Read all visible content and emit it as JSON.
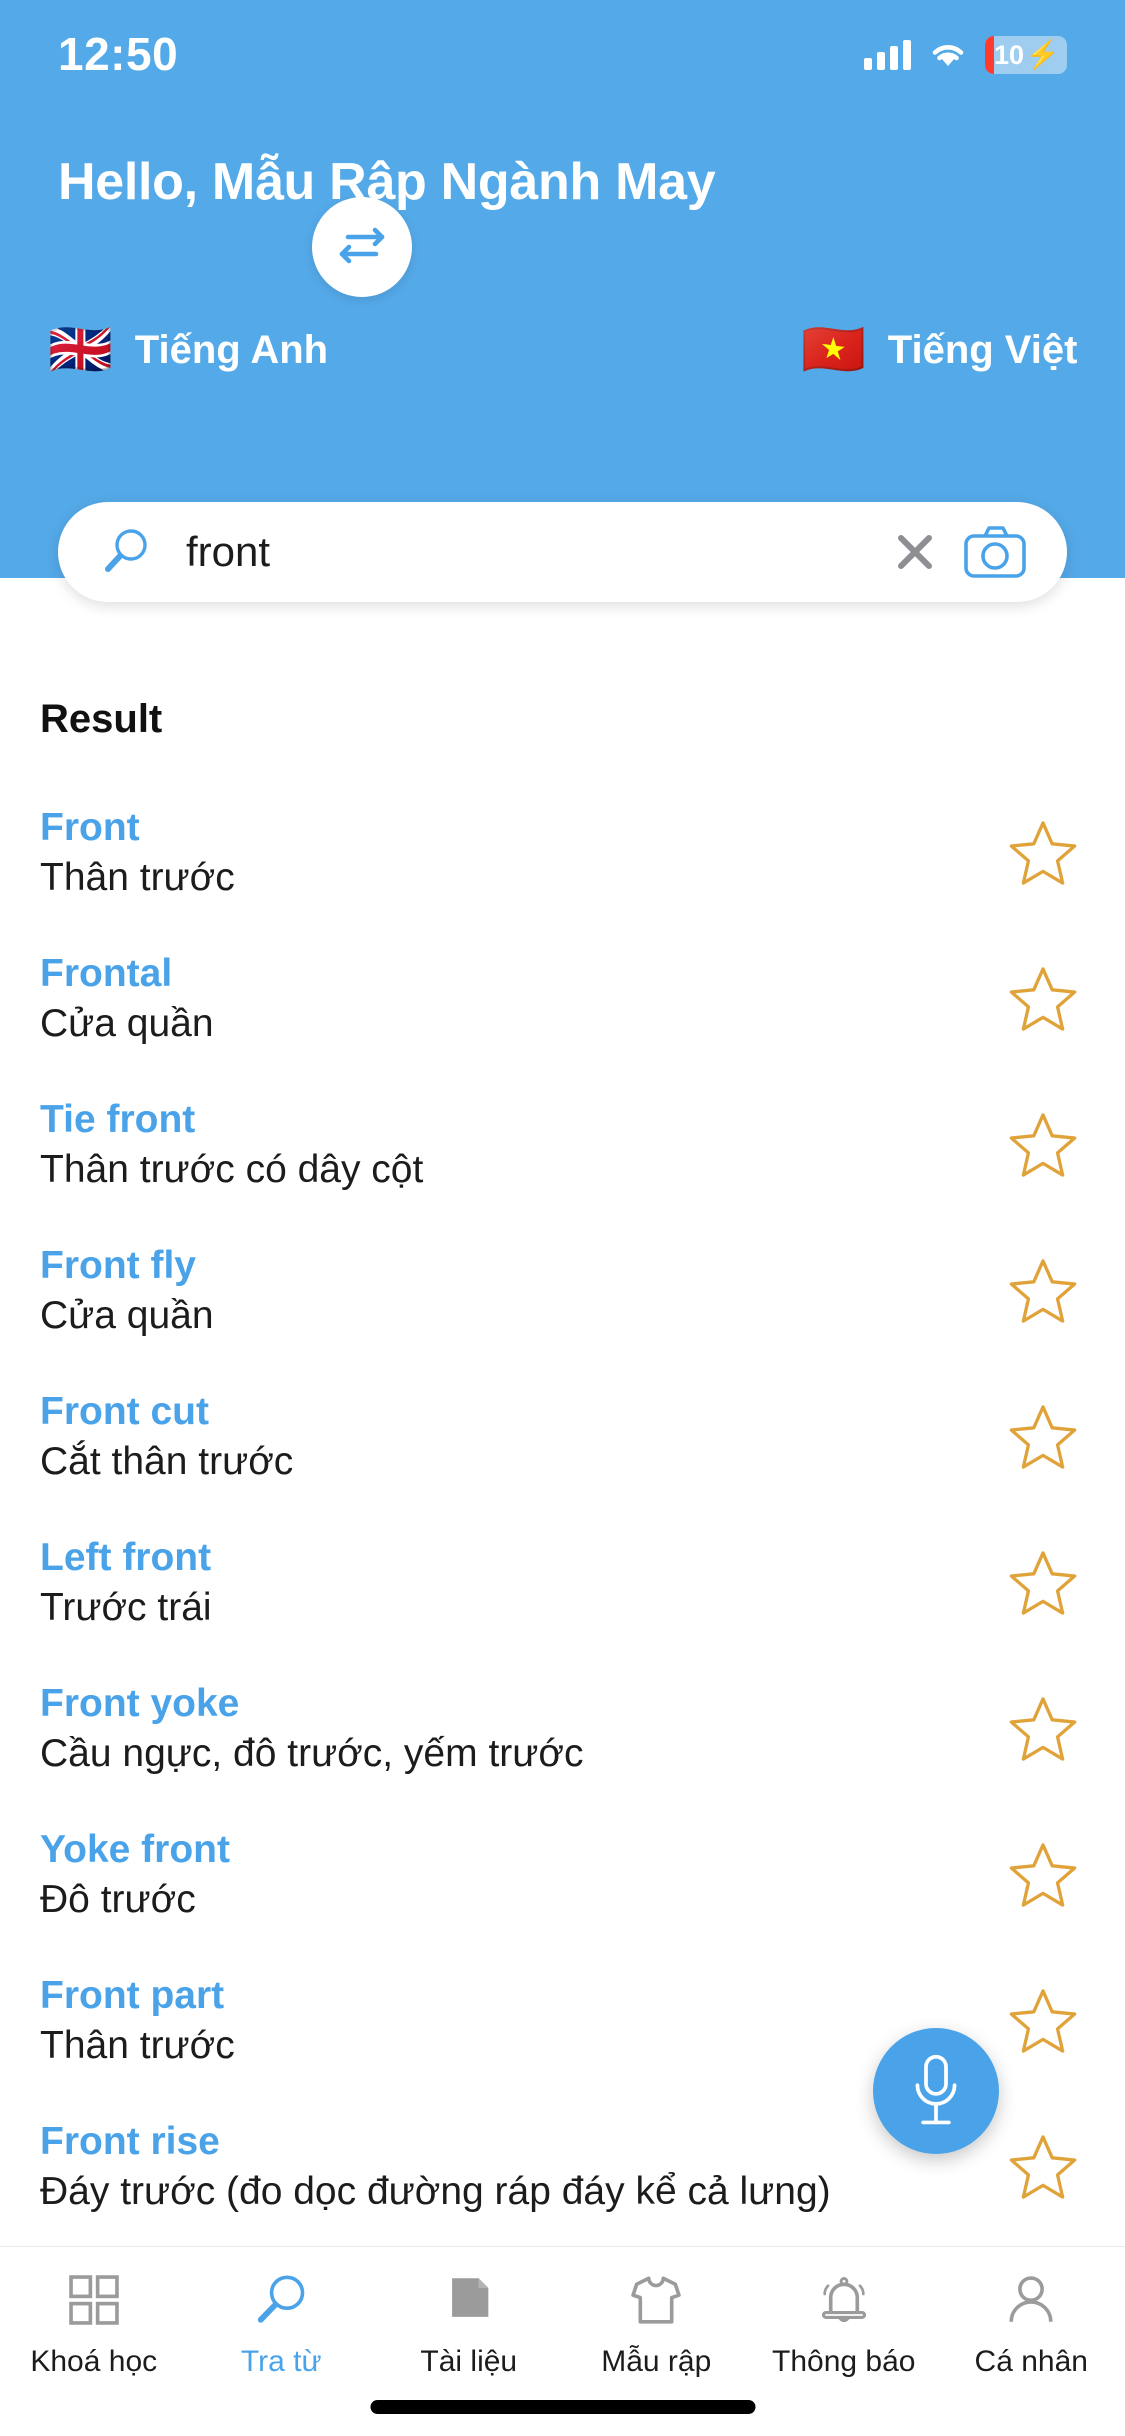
{
  "status_bar": {
    "time": "12:50",
    "battery_percent": "10",
    "charging": true,
    "signal_icon": "signal-bars-icon",
    "wifi_icon": "wifi-icon",
    "battery_icon": "battery-icon"
  },
  "header": {
    "greeting": "Hello, Mẫu Rập Ngành May",
    "background_color": "#54a9e8",
    "source_language": {
      "label": "Tiếng Anh",
      "flag": "🇬🇧"
    },
    "target_language": {
      "label": "Tiếng Việt",
      "flag": "🇻🇳"
    },
    "swap_icon": "swap-horizontal-icon"
  },
  "search": {
    "value": "front",
    "placeholder": "front",
    "search_icon": "search-icon",
    "clear_icon": "close-icon",
    "camera_icon": "camera-icon"
  },
  "results": {
    "title": "Result",
    "accent_color": "#4aa3e8",
    "star_color": "#e0a33a",
    "items": [
      {
        "term": "Front",
        "meaning": "Thân trước",
        "star_icon": "star-outline-icon"
      },
      {
        "term": "Frontal",
        "meaning": "Cửa quần",
        "star_icon": "star-outline-icon"
      },
      {
        "term": "Tie front",
        "meaning": "Thân trước có dây cột",
        "star_icon": "star-outline-icon"
      },
      {
        "term": "Front fly",
        "meaning": "Cửa quần",
        "star_icon": "star-outline-icon"
      },
      {
        "term": "Front cut",
        "meaning": "Cắt thân trước",
        "star_icon": "star-outline-icon"
      },
      {
        "term": "Left front",
        "meaning": "Trước trái",
        "star_icon": "star-outline-icon"
      },
      {
        "term": "Front yoke",
        "meaning": "Cầu ngực, đô trước, yếm trước",
        "star_icon": "star-outline-icon"
      },
      {
        "term": "Yoke front",
        "meaning": "Đô trước",
        "star_icon": "star-outline-icon"
      },
      {
        "term": "Front part",
        "meaning": "Thân trước",
        "star_icon": "star-outline-icon"
      },
      {
        "term": "Front rise",
        "meaning": "Đáy trước (đo dọc đường ráp đáy kể cả lưng)",
        "star_icon": "star-outline-icon"
      }
    ]
  },
  "mic_button": {
    "icon": "microphone-icon",
    "color": "#4aa3e8"
  },
  "tabbar": {
    "active_index": 1,
    "items": [
      {
        "label": "Khoá học",
        "icon": "grid-icon"
      },
      {
        "label": "Tra từ",
        "icon": "search-icon"
      },
      {
        "label": "Tài liệu",
        "icon": "document-icon"
      },
      {
        "label": "Mẫu rập",
        "icon": "tshirt-icon"
      },
      {
        "label": "Thông báo",
        "icon": "bell-icon"
      },
      {
        "label": "Cá nhân",
        "icon": "person-icon"
      }
    ]
  }
}
